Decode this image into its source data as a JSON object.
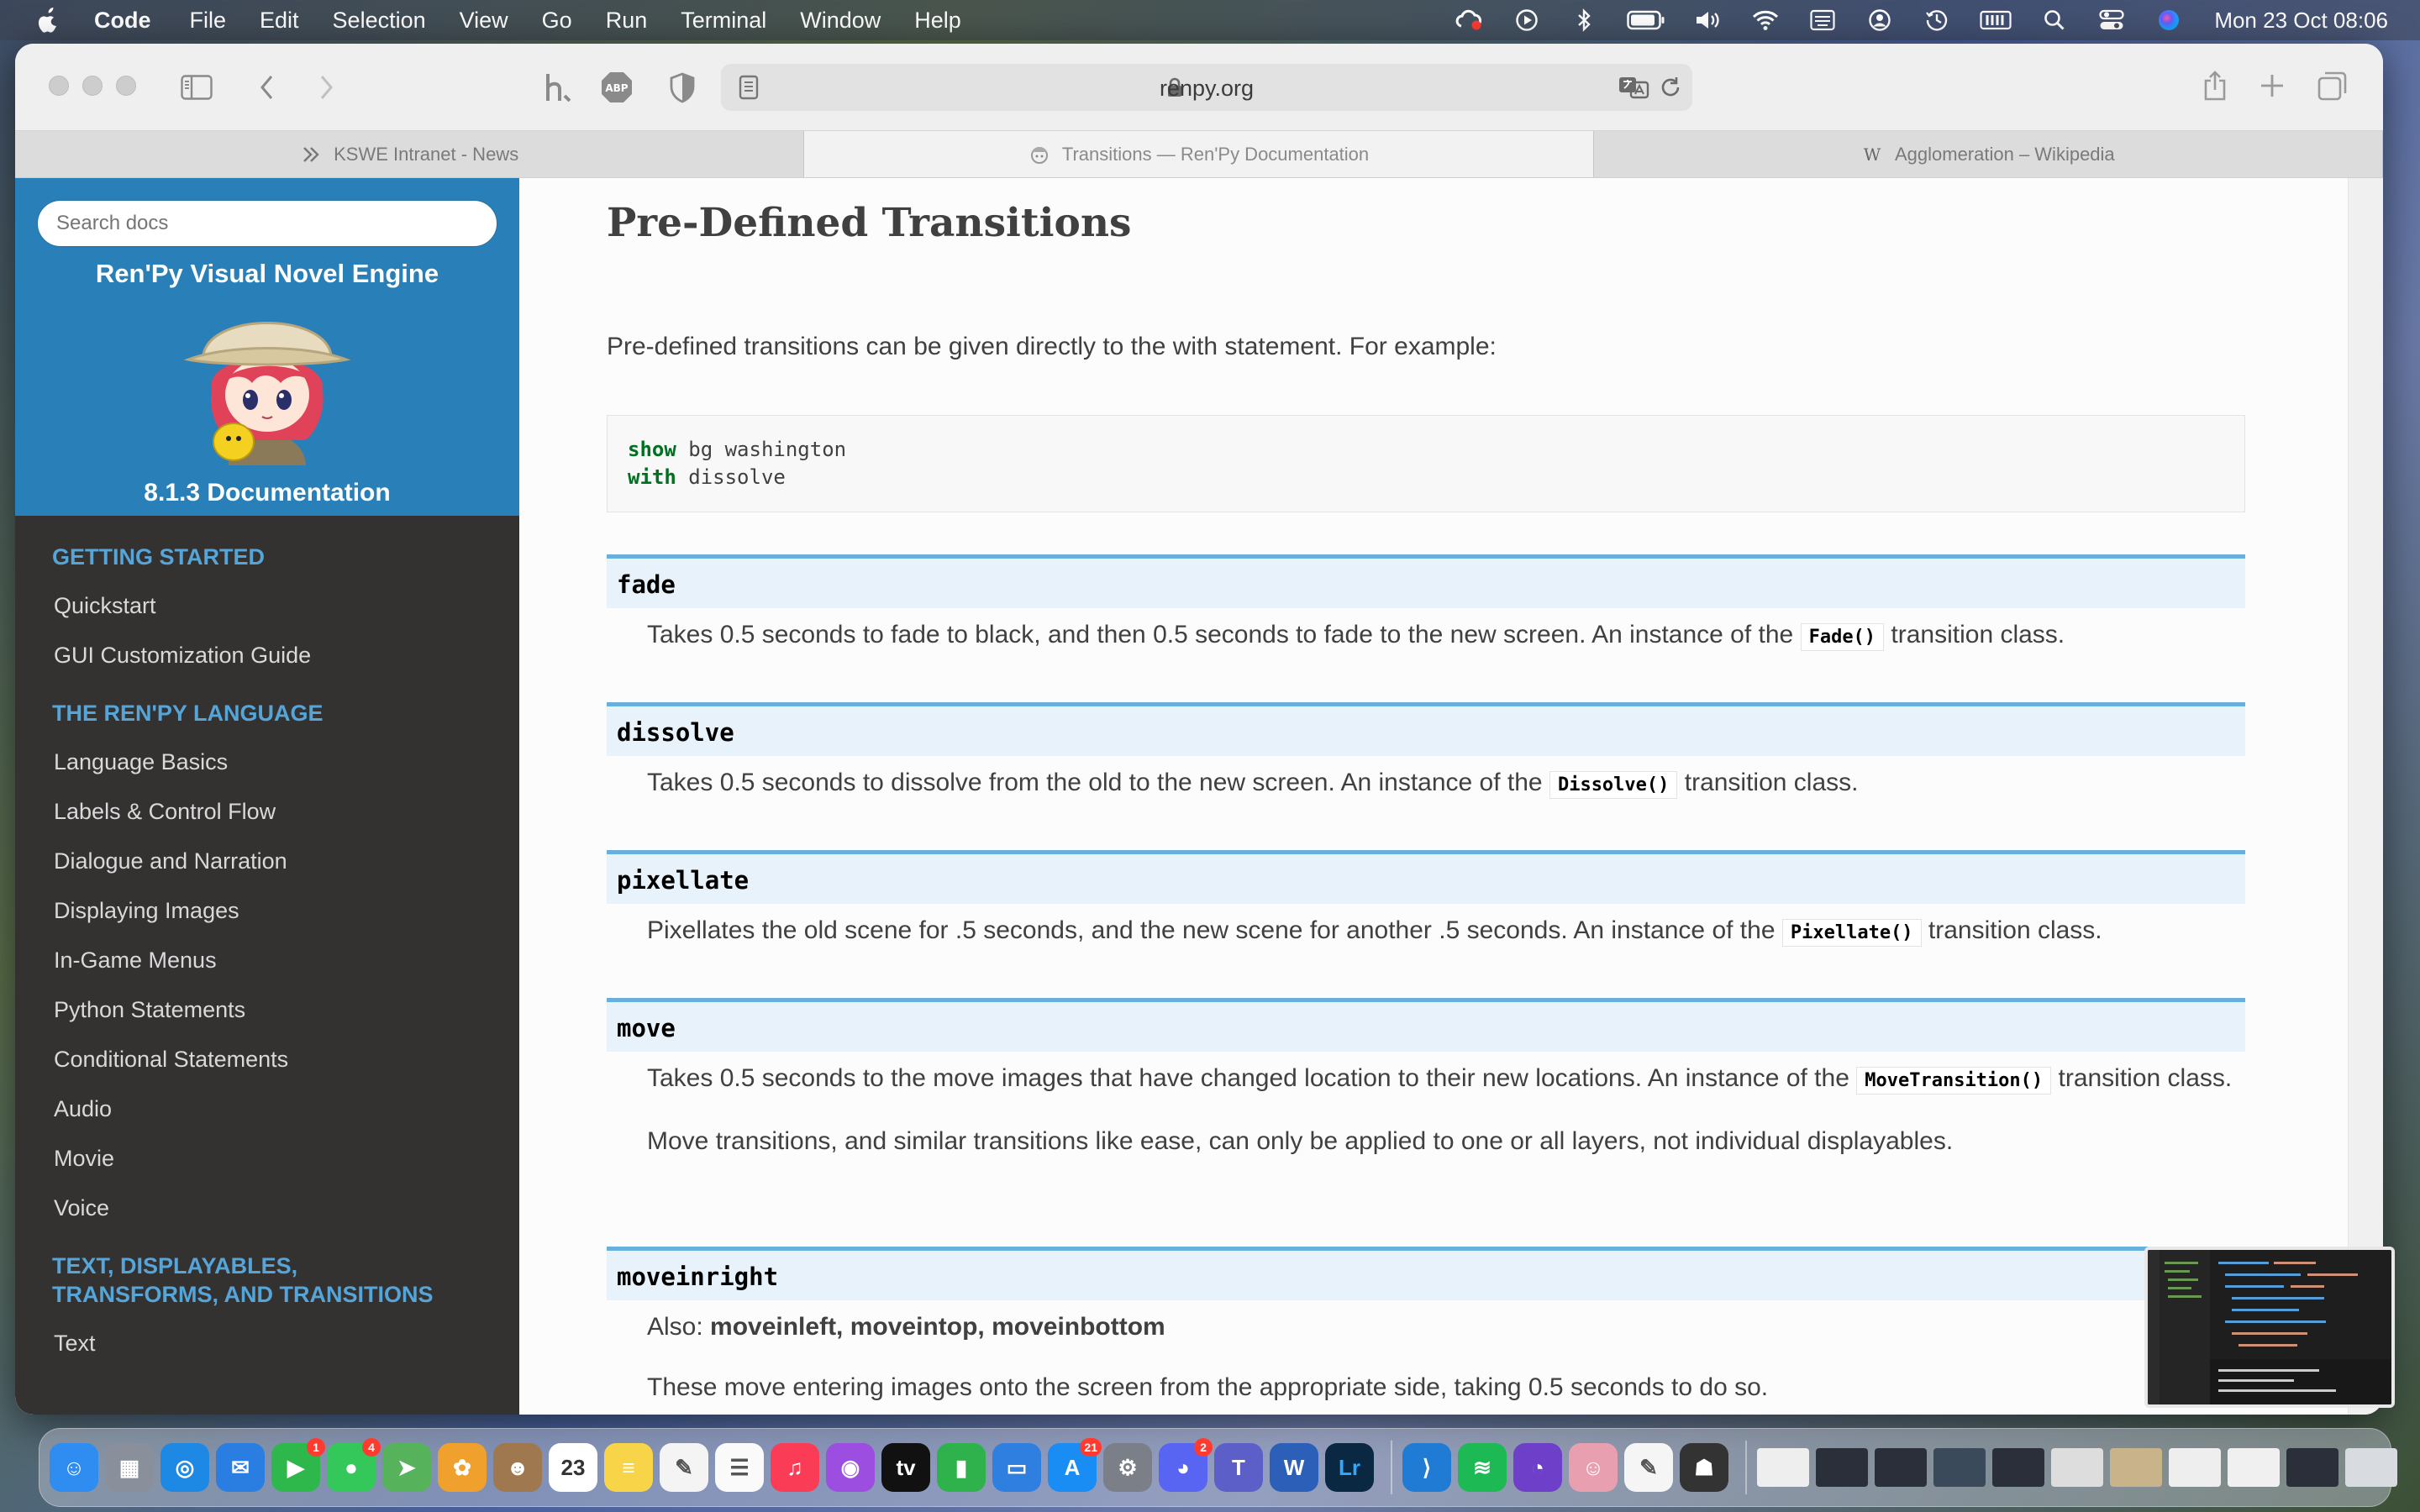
{
  "menubar": {
    "app_name": "Code",
    "menus": [
      "File",
      "Edit",
      "Selection",
      "View",
      "Go",
      "Run",
      "Terminal",
      "Window",
      "Help"
    ],
    "clock": "Mon 23 Oct  08:06",
    "tray_icons": [
      "creative-cloud-icon",
      "play-icon",
      "bluetooth-icon",
      "battery-icon",
      "volume-icon",
      "wifi-icon",
      "keyboard-input-icon",
      "user-icon",
      "clock-history-icon",
      "memory-icon",
      "spotlight-search-icon",
      "control-center-icon",
      "siri-icon"
    ]
  },
  "browser": {
    "url": "renpy.org",
    "tabs": [
      {
        "label": "KSWE Intranet - News",
        "icon": "teams-icon"
      },
      {
        "label": "Transitions — Ren'Py Documentation",
        "icon": "renpy-icon"
      },
      {
        "label": "Agglomeration – Wikipedia",
        "icon": "wikipedia-icon",
        "favicon_text": "W"
      }
    ],
    "active_tab": 1
  },
  "sidebar": {
    "search_placeholder": "Search docs",
    "project": "Ren'Py Visual Novel Engine",
    "version": "8.1.3 Documentation",
    "sections": [
      {
        "caption": "GETTING STARTED",
        "links": [
          "Quickstart",
          "GUI Customization Guide"
        ]
      },
      {
        "caption": "THE REN'PY LANGUAGE",
        "links": [
          "Language Basics",
          "Labels & Control Flow",
          "Dialogue and Narration",
          "Displaying Images",
          "In-Game Menus",
          "Python Statements",
          "Conditional Statements",
          "Audio",
          "Movie",
          "Voice"
        ]
      },
      {
        "caption": "TEXT, DISPLAYABLES, TRANSFORMS, AND TRANSITIONS",
        "links": [
          "Text"
        ]
      }
    ]
  },
  "content": {
    "title": "Pre-Defined Transitions",
    "intro": "Pre-defined transitions can be given directly to the with statement. For example:",
    "code": [
      {
        "keyword": "show",
        "rest": " bg washington"
      },
      {
        "keyword": "with",
        "rest": " dissolve"
      }
    ],
    "transitions": [
      {
        "name": "fade",
        "desc_before": "Takes 0.5 seconds to fade to black, and then 0.5 seconds to fade to the new screen. An instance of the ",
        "literal": "Fade()",
        "desc_after": " transition class."
      },
      {
        "name": "dissolve",
        "desc_before": "Takes 0.5 seconds to dissolve from the old to the new screen. An instance of the ",
        "literal": "Dissolve()",
        "desc_after": " transition class."
      },
      {
        "name": "pixellate",
        "desc_before": "Pixellates the old scene for .5 seconds, and the new scene for another .5 seconds. An instance of the ",
        "literal": "Pixellate()",
        "desc_after": " transition class."
      },
      {
        "name": "move",
        "desc_before": "Takes 0.5 seconds to the move images that have changed location to their new locations. An instance of the ",
        "literal": "MoveTransition()",
        "desc_after": " transition class.",
        "extra": "Move transitions, and similar transitions like ease, can only be applied to one or all layers, not individual displayables."
      },
      {
        "name": "moveinright",
        "also_label": "Also: ",
        "also": "moveinleft, moveintop, moveinbottom",
        "extra": "These move entering images onto the screen from the appropriate side, taking 0.5 seconds to do so."
      }
    ]
  },
  "dock": {
    "apps": [
      {
        "name": "finder-icon",
        "color": "#2f8cf0",
        "glyph": "☺"
      },
      {
        "name": "launchpad-icon",
        "color": "#8a8f9c",
        "glyph": "▦"
      },
      {
        "name": "safari-icon",
        "color": "#1e88e5",
        "glyph": "◎"
      },
      {
        "name": "mail-icon",
        "color": "#2a7de1",
        "glyph": "✉"
      },
      {
        "name": "facetime-icon",
        "color": "#2eb84b",
        "glyph": "▶",
        "badge": "1"
      },
      {
        "name": "messages-icon",
        "color": "#34c759",
        "glyph": "●",
        "badge": "4"
      },
      {
        "name": "maps-icon",
        "color": "#57b35b",
        "glyph": "➤"
      },
      {
        "name": "photos-icon",
        "color": "#f0a02c",
        "glyph": "✿"
      },
      {
        "name": "contacts-icon",
        "color": "#a07850",
        "glyph": "☻"
      },
      {
        "name": "calendar-icon",
        "color": "#ffffff",
        "glyph": "23",
        "text_color": "#333333"
      },
      {
        "name": "notes-icon",
        "color": "#f8d548",
        "glyph": "≡",
        "text_color": "#ffffff"
      },
      {
        "name": "freeform-icon",
        "color": "#f4f4f4",
        "glyph": "✎",
        "text_color": "#555555"
      },
      {
        "name": "reminders-icon",
        "color": "#fafafa",
        "glyph": "☰",
        "text_color": "#555555"
      },
      {
        "name": "music-icon",
        "color": "#fa3c57",
        "glyph": "♫"
      },
      {
        "name": "podcasts-icon",
        "color": "#9b4ee0",
        "glyph": "◉"
      },
      {
        "name": "apple-tv-icon",
        "color": "#111111",
        "glyph": "tv"
      },
      {
        "name": "numbers-icon",
        "color": "#2fb24c",
        "glyph": "▮"
      },
      {
        "name": "keynote-icon",
        "color": "#2f7fe0",
        "glyph": "▭"
      },
      {
        "name": "app-store-icon",
        "color": "#1a8df5",
        "glyph": "A",
        "badge": "21"
      },
      {
        "name": "system-settings-icon",
        "color": "#7b7f88",
        "glyph": "⚙"
      },
      {
        "name": "discord-icon",
        "color": "#5865f2",
        "glyph": "◕",
        "badge": "2"
      },
      {
        "name": "teams-icon",
        "color": "#5b5fc7",
        "glyph": "T"
      },
      {
        "name": "word-icon",
        "color": "#2b5fb8",
        "glyph": "W"
      },
      {
        "name": "lightroom-icon",
        "color": "#0b2843",
        "glyph": "Lr",
        "text_color": "#30a8ff"
      },
      {
        "name": "vscode-icon",
        "color": "#1f7bd4",
        "glyph": "⟩",
        "sep_before": true
      },
      {
        "name": "spotify-icon",
        "color": "#1db954",
        "glyph": "≋"
      },
      {
        "name": "github-desktop-icon",
        "color": "#6e40c9",
        "glyph": "◔"
      },
      {
        "name": "renpy-app-icon",
        "color": "#e8a0b0",
        "glyph": "☺"
      },
      {
        "name": "textedit-icon",
        "color": "#f5f5f5",
        "glyph": "✎",
        "text_color": "#555555"
      },
      {
        "name": "destinys-reminder-icon",
        "color": "#333333",
        "glyph": "☗"
      }
    ],
    "windows": [
      {
        "name": "minimized-document-icon",
        "color": "#eeeeee"
      },
      {
        "name": "minimized-window-icon",
        "color": "#2b2f3a"
      },
      {
        "name": "minimized-window-icon",
        "color": "#2b2f3a"
      },
      {
        "name": "minimized-window-icon",
        "color": "#3b4a5a"
      },
      {
        "name": "minimized-window-icon",
        "color": "#2b2f3a"
      },
      {
        "name": "minimized-window-icon",
        "color": "#dddddd"
      },
      {
        "name": "minimized-window-icon",
        "color": "#c9b38a"
      },
      {
        "name": "minimized-window-icon",
        "color": "#eeeeee"
      },
      {
        "name": "minimized-window-icon",
        "color": "#f0f0f0"
      },
      {
        "name": "minimized-window-icon",
        "color": "#2b2f3a"
      },
      {
        "name": "trash-icon",
        "color": "#d8dbe0"
      }
    ]
  }
}
